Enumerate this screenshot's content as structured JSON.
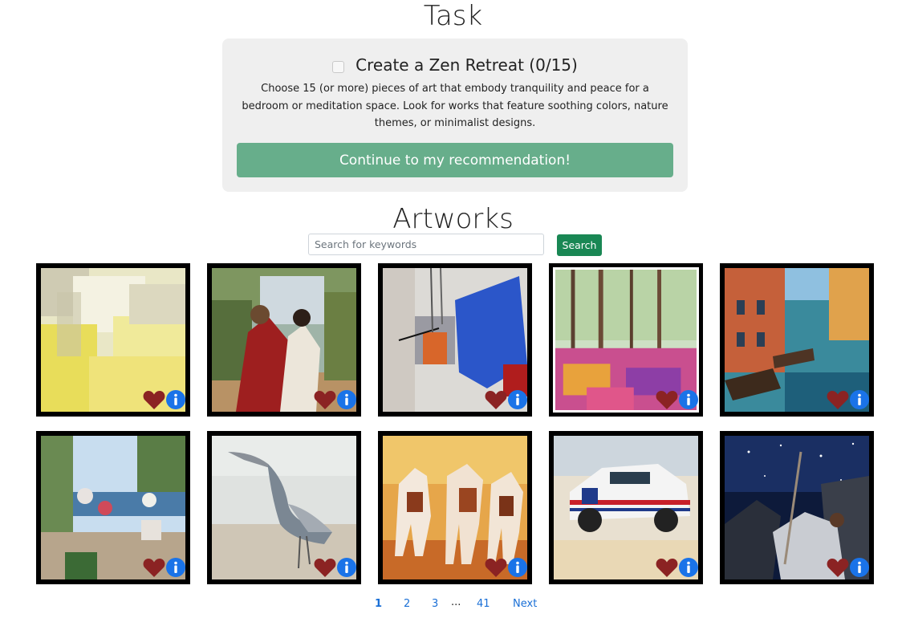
{
  "task": {
    "heading": "Task",
    "title": "Create a Zen Retreat (0/15)",
    "description": "Choose 15 (or more) pieces of art that embody tranquility and peace for a bedroom or meditation space. Look for works that feature soothing colors, nature themes, or minimalist designs.",
    "continue_label": "Continue to my recommendation!"
  },
  "artworks": {
    "heading": "Artworks",
    "search_placeholder": "Search for keywords",
    "search_label": "Search",
    "items": [
      {
        "subject": "abstract yellow white painting"
      },
      {
        "subject": "jesus and woman at well"
      },
      {
        "subject": "abstract blue red composition"
      },
      {
        "subject": "colorful forest meadow"
      },
      {
        "subject": "venice canal with boats"
      },
      {
        "subject": "garden terrace by the sea"
      },
      {
        "subject": "heron on beach"
      },
      {
        "subject": "three running horses"
      },
      {
        "subject": "vintage rally car"
      },
      {
        "subject": "figure under starry sky"
      }
    ]
  },
  "pagination": {
    "pages": [
      "1",
      "2",
      "3",
      "41"
    ],
    "ellipsis": "...",
    "next_label": "Next",
    "current": "1"
  },
  "colors": {
    "heart": "#8b2323",
    "info": "#1a73e8",
    "continue_button": "#67ae8b",
    "search_button": "#198754"
  }
}
